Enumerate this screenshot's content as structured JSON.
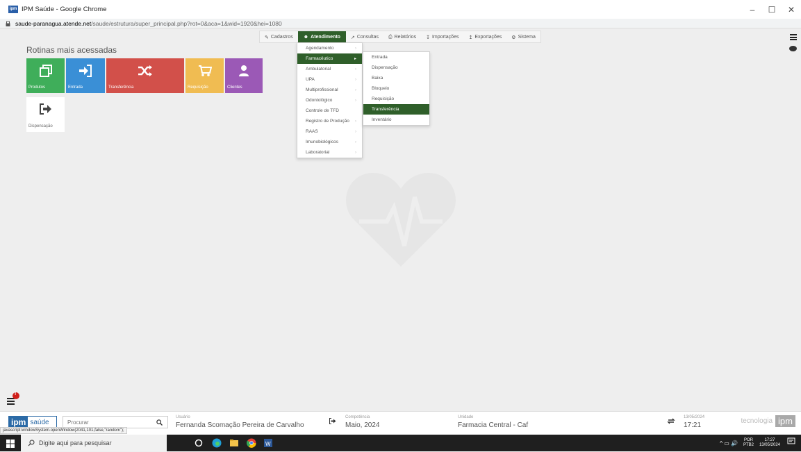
{
  "window": {
    "title": "IPM Saúde - Google Chrome",
    "app_icon_text": "ipm",
    "url_host": "saude-paranagua.atende.net",
    "url_path": "/saude/estrutura/super_principal.php?rot=0&aca=1&wid=1920&hei=1080"
  },
  "menubar": [
    {
      "label": "Cadastros",
      "icon": "edit-icon"
    },
    {
      "label": "Atendimento",
      "icon": "users-icon",
      "active": true
    },
    {
      "label": "Consultas",
      "icon": "chart-icon"
    },
    {
      "label": "Relatórios",
      "icon": "print-icon"
    },
    {
      "label": "Importações",
      "icon": "download-icon"
    },
    {
      "label": "Exportações",
      "icon": "upload-icon"
    },
    {
      "label": "Sistema",
      "icon": "gear-icon"
    }
  ],
  "section_title": "Rotinas mais acessadas",
  "tiles": [
    {
      "label": "Produtos",
      "color": "#3fae5a",
      "icon": "copy-icon"
    },
    {
      "label": "Entrada",
      "color": "#3a8fd6",
      "icon": "sign-in-icon"
    },
    {
      "label": "Transferência",
      "color": "#d2504a",
      "icon": "shuffle-icon"
    },
    {
      "label": "Requisição",
      "color": "#f0bc52",
      "icon": "cart-icon"
    },
    {
      "label": "Clientes",
      "color": "#9b59b6",
      "icon": "user-icon"
    },
    {
      "label": "Dispensação",
      "color": "#ffffff",
      "icon": "sign-out-icon"
    }
  ],
  "atendimento_menu": [
    {
      "label": "Agendamento"
    },
    {
      "label": "Farmacêutico",
      "highlight": true
    },
    {
      "label": "Ambulatorial"
    },
    {
      "label": "UPA"
    },
    {
      "label": "Multiprofissional"
    },
    {
      "label": "Odontológico"
    },
    {
      "label": "Controle de TFD"
    },
    {
      "label": "Registro de Produção"
    },
    {
      "label": "RAAS"
    },
    {
      "label": "Imunobiológicos"
    },
    {
      "label": "Laboratorial"
    }
  ],
  "farmaceutico_menu": [
    {
      "label": "Entrada"
    },
    {
      "label": "Dispensação"
    },
    {
      "label": "Baixa"
    },
    {
      "label": "Bloqueio"
    },
    {
      "label": "Requisição"
    },
    {
      "label": "Transferência",
      "highlight": true
    },
    {
      "label": "Inventário"
    }
  ],
  "notification_count": "!",
  "footer": {
    "logo_ipm": "ipm",
    "logo_saude": "saúde",
    "search_placeholder": "Procurar",
    "usuario_label": "Usuário",
    "usuario_value": "Fernanda Scomação Pereira de Carvalho",
    "competencia_label": "Competência",
    "competencia_value": "Maio, 2024",
    "unidade_label": "Unidade",
    "unidade_value": "Farmacia Central - Caf",
    "date": "13/05/2024",
    "time": "17:21",
    "tec_text": "tecnologia",
    "tec_ipm": "ipm",
    "status_tip": "javascript:windowSystem.openWindow(2041,101,false,\"random\");"
  },
  "taskbar": {
    "search_text": "Digite aqui para pesquisar",
    "lang_top": "POR",
    "lang_bottom": "PTB2",
    "clock_time": "17:27",
    "clock_date": "13/05/2024"
  }
}
